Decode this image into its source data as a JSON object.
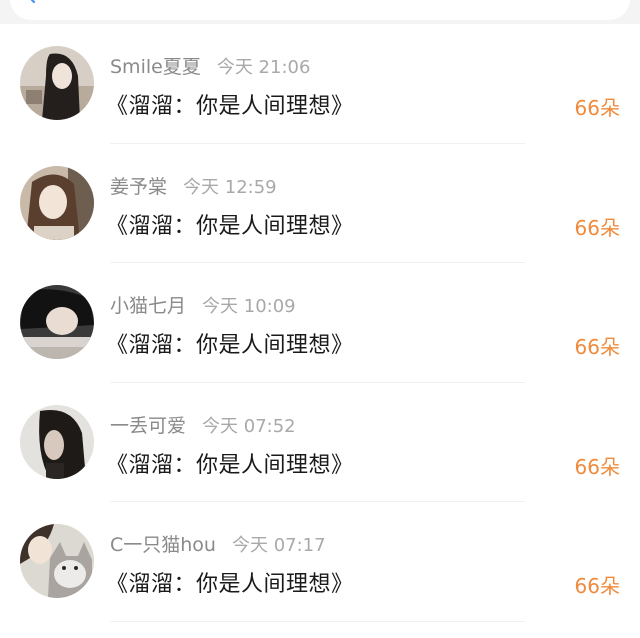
{
  "colors": {
    "accent": "#f08a3c",
    "name_text": "#8a8a8a",
    "time_text": "#a9a9a9",
    "title_text": "#1a1a1a"
  },
  "search": {
    "icon": "search-icon"
  },
  "items": [
    {
      "name": "Smile夏夏",
      "time": "今天 21:06",
      "title": "《溜溜：你是人间理想》",
      "count": "66朵"
    },
    {
      "name": "姜予棠",
      "time": "今天 12:59",
      "title": "《溜溜：你是人间理想》",
      "count": "66朵"
    },
    {
      "name": "小猫七月",
      "time": "今天 10:09",
      "title": "《溜溜：你是人间理想》",
      "count": "66朵"
    },
    {
      "name": "一丢可爱",
      "time": "今天 07:52",
      "title": "《溜溜：你是人间理想》",
      "count": "66朵"
    },
    {
      "name": "C一只猫hou",
      "time": "今天 07:17",
      "title": "《溜溜：你是人间理想》",
      "count": "66朵"
    }
  ]
}
